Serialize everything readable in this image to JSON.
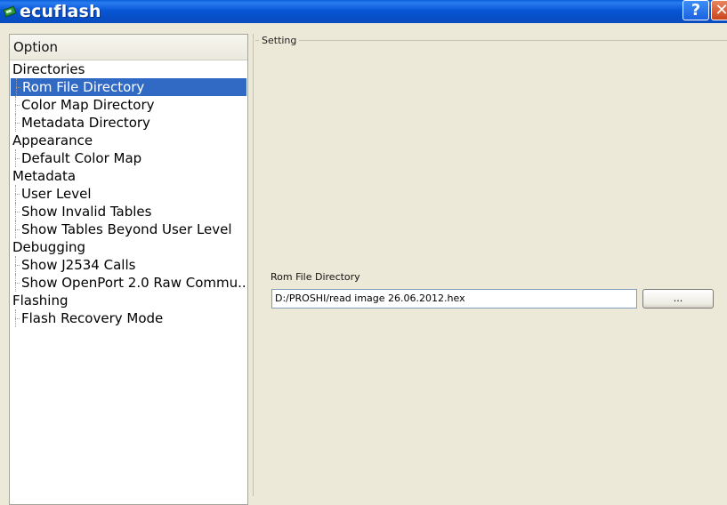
{
  "window": {
    "title": "ecuflash",
    "help_label": "?",
    "close_label": "✕"
  },
  "tree": {
    "header": "Option",
    "items": [
      {
        "label": "Directories",
        "level": 0
      },
      {
        "label": "Rom File Directory",
        "level": 1,
        "selected": true
      },
      {
        "label": "Color Map Directory",
        "level": 1
      },
      {
        "label": "Metadata Directory",
        "level": 1
      },
      {
        "label": "Appearance",
        "level": 0
      },
      {
        "label": "Default Color Map",
        "level": 1
      },
      {
        "label": "Metadata",
        "level": 0
      },
      {
        "label": "User Level",
        "level": 1
      },
      {
        "label": "Show Invalid Tables",
        "level": 1
      },
      {
        "label": "Show Tables Beyond User Level",
        "level": 1
      },
      {
        "label": "Debugging",
        "level": 0
      },
      {
        "label": "Show J2534 Calls",
        "level": 1
      },
      {
        "label": "Show OpenPort 2.0 Raw Commu...",
        "level": 1
      },
      {
        "label": "Flashing",
        "level": 0
      },
      {
        "label": "Flash Recovery Mode",
        "level": 1
      }
    ]
  },
  "setting": {
    "group_title": "Setting",
    "field_label": "Rom File Directory",
    "path_value": "D:/PROSHI/read image 26.06.2012.hex",
    "browse_label": "..."
  },
  "colors": {
    "titlebar": "#0856d6",
    "selection": "#316ac5",
    "window_bg": "#ece9d8"
  }
}
